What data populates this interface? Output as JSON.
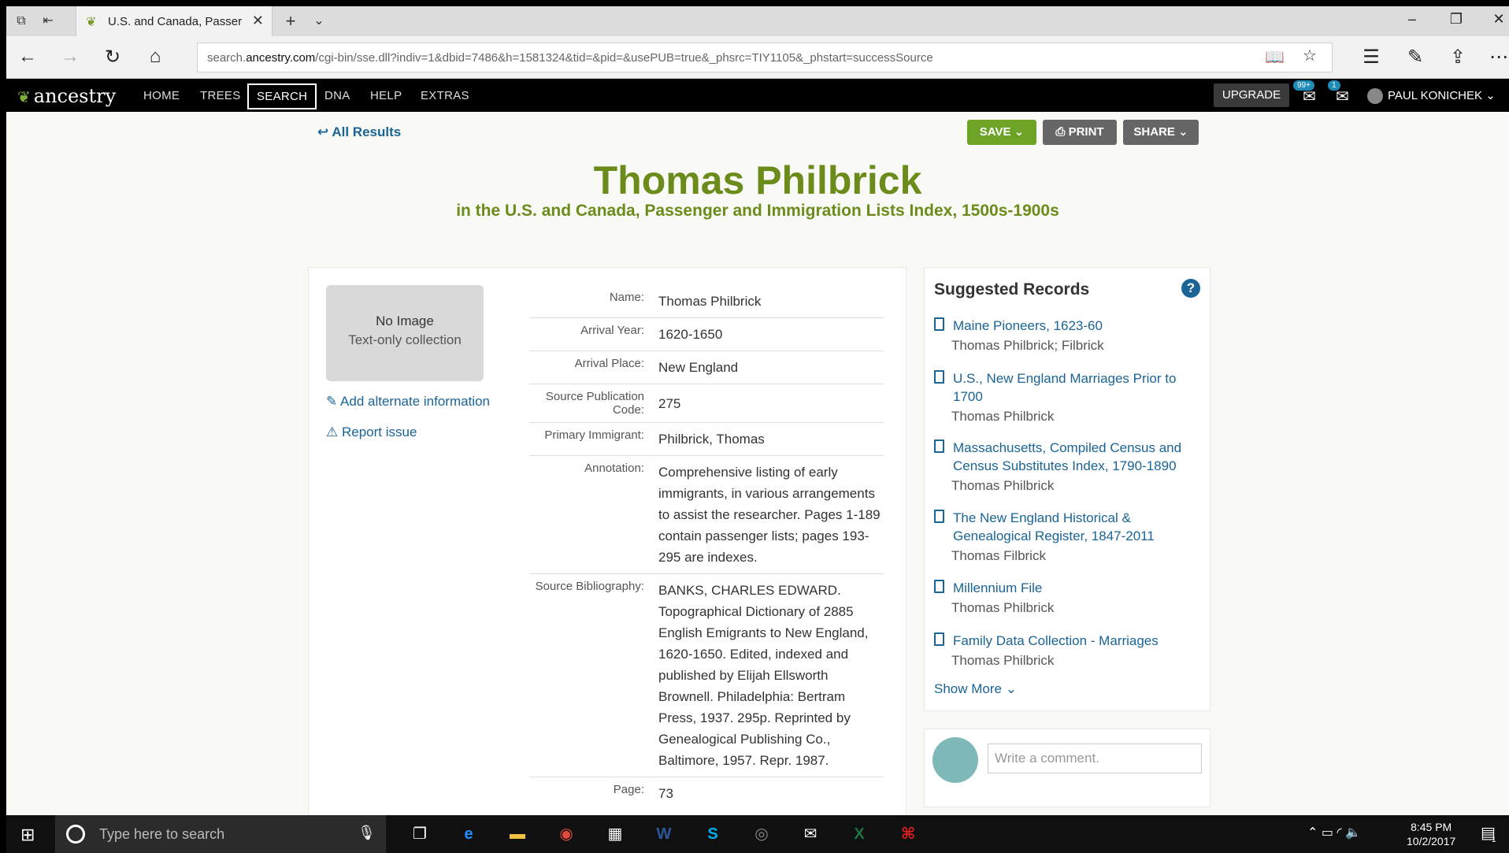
{
  "browser": {
    "tab_title": "U.S. and Canada, Passer",
    "url_prefix": "search.",
    "url_domain": "ancestry.com",
    "url_rest": "/cgi-bin/sse.dll?indiv=1&dbid=7486&h=1581324&tid=&pid=&usePUB=true&_phsrc=TIY1105&_phstart=successSource"
  },
  "nav": {
    "logo": "ancestry",
    "items": [
      "HOME",
      "TREES",
      "SEARCH",
      "DNA",
      "HELP",
      "EXTRAS"
    ],
    "upgrade": "UPGRADE",
    "notif_badge": "99+",
    "mail_badge": "1",
    "user": "PAUL KONICHEK"
  },
  "page": {
    "back_link": "All Results",
    "save": "SAVE",
    "print": "PRINT",
    "share": "SHARE",
    "title": "Thomas Philbrick",
    "subtitle": "in the U.S. and Canada, Passenger and Immigration Lists Index, 1500s-1900s"
  },
  "record": {
    "thumb_line1": "No Image",
    "thumb_line2": "Text-only collection",
    "add_alt": "Add alternate information",
    "report": "Report issue",
    "fields": [
      {
        "label": "Name:",
        "value": "Thomas Philbrick"
      },
      {
        "label": "Arrival Year:",
        "value": "1620-1650"
      },
      {
        "label": "Arrival Place:",
        "value": "New England"
      },
      {
        "label": "Source Publication Code:",
        "value": "275"
      },
      {
        "label": "Primary Immigrant:",
        "value": "Philbrick, Thomas"
      },
      {
        "label": "Annotation:",
        "value": "Comprehensive listing of early immigrants, in various arrangements to assist the researcher. Pages 1-189 contain passenger lists; pages 193-295 are indexes."
      },
      {
        "label": "Source Bibliography:",
        "value": "BANKS, CHARLES EDWARD. Topographical Dictionary of 2885 English Emigrants to New England, 1620-1650. Edited, indexed and published by Elijah Ellsworth Brownell. Philadelphia: Bertram Press, 1937. 295p. Reprinted by Genealogical Publishing Co., Baltimore, 1957. Repr. 1987."
      },
      {
        "label": "Page:",
        "value": "73"
      }
    ]
  },
  "suggested": {
    "heading": "Suggested Records",
    "help": "?",
    "items": [
      {
        "title": "Maine Pioneers, 1623-60",
        "name": "Thomas Philbrick; Filbrick"
      },
      {
        "title": "U.S., New England Marriages Prior to 1700",
        "name": "Thomas Philbrick"
      },
      {
        "title": "Massachusetts, Compiled Census and Census Substitutes Index, 1790-1890",
        "name": "Thomas Philbrick"
      },
      {
        "title": "The New England Historical & Genealogical Register, 1847-2011",
        "name": "Thomas Filbrick"
      },
      {
        "title": "Millennium File",
        "name": "Thomas Philbrick"
      },
      {
        "title": "Family Data Collection - Marriages",
        "name": "Thomas Philbrick"
      }
    ],
    "show_more": "Show More"
  },
  "comment": {
    "placeholder": "Write a comment."
  },
  "taskbar": {
    "search_placeholder": "Type here to search",
    "time": "8:45 PM",
    "date": "10/2/2017",
    "notif_count": "1"
  }
}
